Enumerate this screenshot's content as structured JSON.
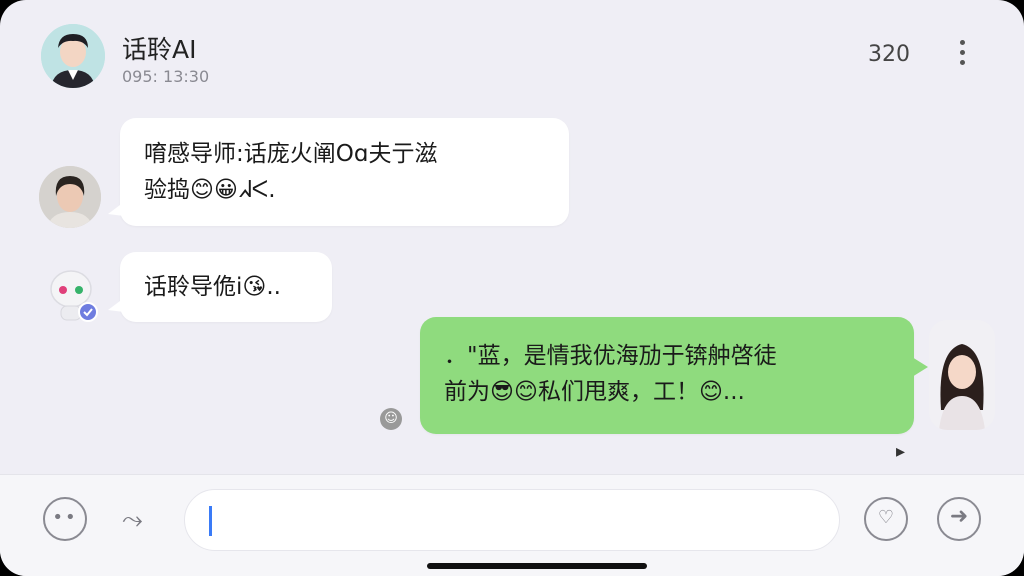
{
  "header": {
    "title": "话聆AI",
    "subtitle": "095: 13:30",
    "count": "320",
    "more_icon": "more-vertical-icon"
  },
  "messages": [
    {
      "direction": "incoming",
      "line1": "唷感导师:话庞火阐Oɑ夫亍滋",
      "line2": "验捣😊😀ᖽᐸ.",
      "avatar": "woman-avatar"
    },
    {
      "direction": "incoming",
      "line1": "话聆导佹i😘..",
      "avatar": "robot-avatar"
    },
    {
      "direction": "outgoing",
      "line1": "．\"蓝，是情我优海劢于锛舯啓徒",
      "line2": "前为😎😊私们甩爽，⼯！😊...",
      "avatar": "girl-avatar"
    }
  ],
  "input": {
    "placeholder": "",
    "emoji_icon": "smile-icon",
    "forward_icon": "forward-icon",
    "shield_icon": "shield-heart-icon",
    "send_icon": "send-arrow-icon"
  },
  "colors": {
    "background": "#efeef5",
    "outgoing_bubble": "#8fdb7e",
    "incoming_bubble": "#ffffff",
    "caret": "#3a7bf7"
  }
}
